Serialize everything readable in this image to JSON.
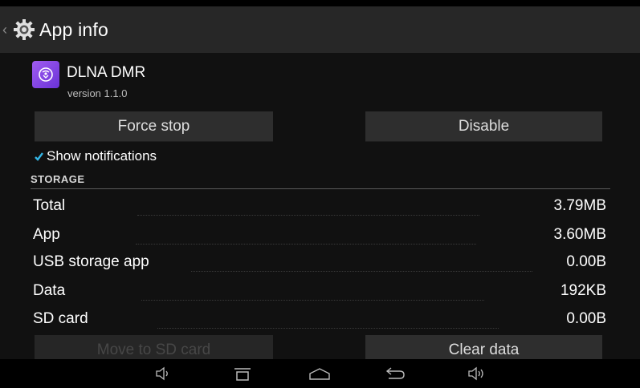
{
  "actionbar": {
    "title": "App info",
    "back": "‹"
  },
  "app": {
    "name": "DLNA DMR",
    "version": "version 1.1.0",
    "icon_color": "#8a4ae6"
  },
  "buttons": {
    "force_stop": "Force stop",
    "disable": "Disable",
    "move_to_sd": "Move to SD card",
    "clear_data": "Clear data"
  },
  "notifications": {
    "label": "Show notifications",
    "checked": true
  },
  "storage": {
    "header": "STORAGE",
    "rows": [
      {
        "label": "Total",
        "value": "3.79MB"
      },
      {
        "label": "App",
        "value": "3.60MB"
      },
      {
        "label": "USB storage app",
        "value": "0.00B"
      },
      {
        "label": "Data",
        "value": "192KB"
      },
      {
        "label": "SD card",
        "value": "0.00B"
      }
    ]
  },
  "navbar": {
    "icons": [
      "volume-down-icon",
      "recent-apps-icon",
      "home-icon",
      "back-icon",
      "volume-up-icon"
    ]
  },
  "colors": {
    "actionbar": "#272727",
    "button": "#2e2e2e",
    "accent": "#33b5e5"
  }
}
